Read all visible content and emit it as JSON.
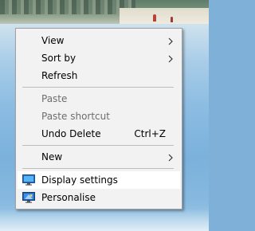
{
  "context_menu": {
    "items": [
      {
        "label": "View",
        "submenu": true,
        "enabled": true
      },
      {
        "label": "Sort by",
        "submenu": true,
        "enabled": true
      },
      {
        "label": "Refresh",
        "enabled": true
      },
      {
        "label": "Paste",
        "enabled": false
      },
      {
        "label": "Paste shortcut",
        "enabled": false
      },
      {
        "label": "Undo Delete",
        "shortcut": "Ctrl+Z",
        "enabled": true
      },
      {
        "label": "New",
        "submenu": true,
        "enabled": true
      },
      {
        "label": "Display settings",
        "icon": "display-icon",
        "enabled": true,
        "highlighted": true
      },
      {
        "label": "Personalise",
        "icon": "personalise-icon",
        "enabled": true
      }
    ]
  },
  "colors": {
    "menu_background": "#f2f2f2",
    "highlight": "#ffffff",
    "disabled_text": "#6d6d6d"
  }
}
